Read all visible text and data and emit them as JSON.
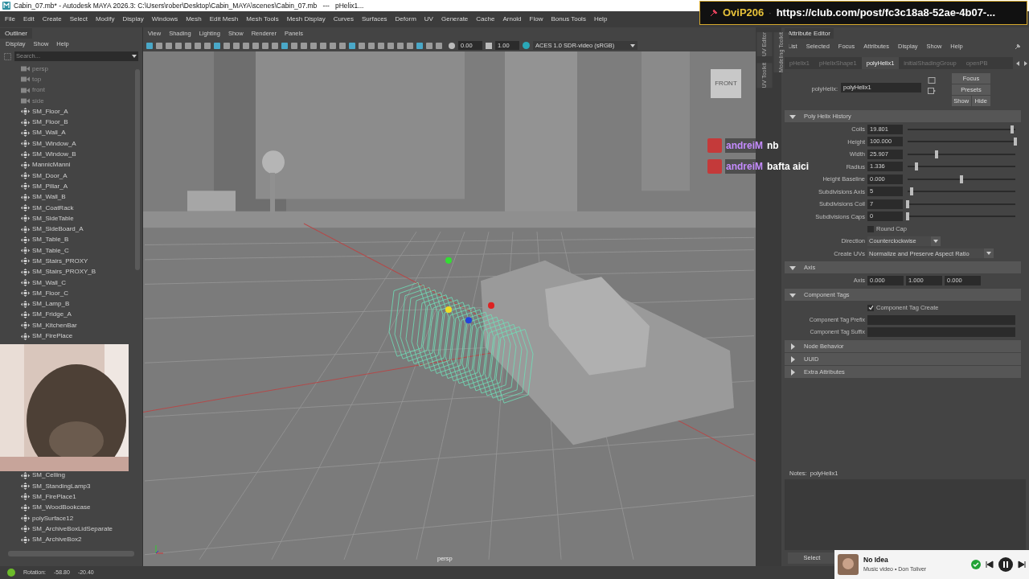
{
  "title_bar": {
    "title": "Cabin_07.mb* - Autodesk MAYA 2026.3: C:\\Users\\rober\\Desktop\\Cabin_MAYA\\scenes\\Cabin_07.mb   ---   pHelix1..."
  },
  "pinned_message": {
    "user": "OviP206",
    "separator": "·",
    "text": "https://club.com/post/fc3c18a8-52ae-4b07-..."
  },
  "menu_bar": [
    "File",
    "Edit",
    "Create",
    "Select",
    "Modify",
    "Display",
    "Windows",
    "Mesh",
    "Edit Mesh",
    "Mesh Tools",
    "Mesh Display",
    "Curves",
    "Surfaces",
    "Deform",
    "UV",
    "Generate",
    "Cache",
    "Arnold",
    "Flow",
    "Bonus Tools",
    "Help"
  ],
  "outliner": {
    "title": "Outliner",
    "menu": [
      "Display",
      "Show",
      "Help"
    ],
    "search_placeholder": "Search...",
    "items_top": [
      {
        "label": "persp",
        "kind": "camera"
      },
      {
        "label": "top",
        "kind": "camera"
      },
      {
        "label": "front",
        "kind": "camera"
      },
      {
        "label": "side",
        "kind": "camera"
      },
      {
        "label": "SM_Floor_A",
        "kind": "mesh"
      },
      {
        "label": "SM_Floor_B",
        "kind": "mesh"
      },
      {
        "label": "SM_Wall_A",
        "kind": "mesh"
      },
      {
        "label": "SM_Window_A",
        "kind": "mesh"
      },
      {
        "label": "SM_Window_B",
        "kind": "mesh"
      },
      {
        "label": "MannicManni",
        "kind": "mesh"
      },
      {
        "label": "SM_Door_A",
        "kind": "mesh"
      },
      {
        "label": "SM_Pillar_A",
        "kind": "mesh"
      },
      {
        "label": "SM_Wall_B",
        "kind": "mesh"
      },
      {
        "label": "SM_CoatRack",
        "kind": "mesh"
      },
      {
        "label": "SM_SideTable",
        "kind": "mesh"
      },
      {
        "label": "SM_SideBoard_A",
        "kind": "mesh"
      },
      {
        "label": "SM_Table_B",
        "kind": "mesh"
      },
      {
        "label": "SM_Table_C",
        "kind": "mesh"
      },
      {
        "label": "SM_Stairs_PROXY",
        "kind": "mesh"
      },
      {
        "label": "SM_Stairs_PROXY_B",
        "kind": "mesh"
      },
      {
        "label": "SM_Wall_C",
        "kind": "mesh"
      },
      {
        "label": "SM_Floor_C",
        "kind": "mesh"
      },
      {
        "label": "SM_Lamp_B",
        "kind": "mesh"
      },
      {
        "label": "SM_Fridge_A",
        "kind": "mesh"
      },
      {
        "label": "SM_KitchenBar",
        "kind": "mesh"
      },
      {
        "label": "SM_FirePlace",
        "kind": "mesh"
      }
    ],
    "items_bottom": [
      {
        "label": "SM_Celling",
        "kind": "mesh"
      },
      {
        "label": "SM_StandingLamp3",
        "kind": "mesh"
      },
      {
        "label": "SM_FirePlace1",
        "kind": "mesh"
      },
      {
        "label": "SM_WoodBookcase",
        "kind": "mesh"
      },
      {
        "label": "polySurface12",
        "kind": "mesh"
      },
      {
        "label": "SM_ArchiveBoxLidSeparate",
        "kind": "mesh"
      },
      {
        "label": "SM_ArchiveBox2",
        "kind": "mesh"
      }
    ]
  },
  "viewport": {
    "menu": [
      "View",
      "Shading",
      "Lighting",
      "Show",
      "Renderer",
      "Panels"
    ],
    "exposure": "0.00",
    "gamma": "1.00",
    "color_space": "ACES 1.0 SDR-video (sRGB)",
    "view_cube": "FRONT",
    "camera": "persp"
  },
  "side_tabs": [
    "UV Editor",
    "Modeling Toolkit",
    "UV Toolkit"
  ],
  "chat": [
    {
      "user": "andreiM",
      "message": "nb"
    },
    {
      "user": "andreiM",
      "message": "bafta aici"
    }
  ],
  "attribute_editor": {
    "title": "Attribute Editor",
    "menu": [
      "List",
      "Selected",
      "Focus",
      "Attributes",
      "Display",
      "Show",
      "Help"
    ],
    "tabs": [
      {
        "label": "pHelix1",
        "selected": false
      },
      {
        "label": "pHelixShape1",
        "selected": false
      },
      {
        "label": "polyHelix1",
        "selected": true
      },
      {
        "label": "initialShadingGroup",
        "selected": false
      },
      {
        "label": "openPB",
        "selected": false
      }
    ],
    "node_label": "polyHelix:",
    "node_value": "polyHelix1",
    "buttons": [
      "Focus",
      "Presets",
      "Show",
      "Hide"
    ],
    "sections": [
      {
        "title": "Poly Helix History",
        "expanded": true,
        "rows": [
          {
            "kind": "slider",
            "label": "Coils",
            "value": "19.801",
            "level": 0.97
          },
          {
            "kind": "slider",
            "label": "Height",
            "value": "100.000",
            "level": 1.0
          },
          {
            "kind": "slider",
            "label": "Width",
            "value": "25.907",
            "level": 0.27
          },
          {
            "kind": "slider",
            "label": "Radius",
            "value": "1.336",
            "level": 0.08
          },
          {
            "kind": "slider",
            "label": "Height Baseline",
            "value": "0.000",
            "level": 0.5
          },
          {
            "kind": "slider",
            "label": "Subdivisions Axis",
            "value": "5",
            "level": 0.04
          },
          {
            "kind": "slider",
            "label": "Subdivisions Coil",
            "value": "7",
            "level": 0.0
          },
          {
            "kind": "slider",
            "label": "Subdivisions Caps",
            "value": "0",
            "level": 0.0
          },
          {
            "kind": "checkbox",
            "label": "Round Cap",
            "checked": false
          },
          {
            "kind": "dropdown",
            "label": "Direction",
            "value": "Counterclockwise"
          },
          {
            "kind": "dropdown",
            "label": "Create UVs",
            "value": "Normalize and Preserve Aspect Ratio"
          }
        ]
      },
      {
        "title": "Axis",
        "expanded": true,
        "rows": [
          {
            "kind": "vector",
            "label": "Axis",
            "values": [
              "0.000",
              "1.000",
              "0.000"
            ]
          }
        ]
      },
      {
        "title": "Component Tags",
        "expanded": true,
        "rows": [
          {
            "kind": "checkbox",
            "label": "Component Tag Create",
            "checked": true
          },
          {
            "kind": "text_field",
            "label": "Component Tag Prefix"
          },
          {
            "kind": "text_field",
            "label": "Component Tag Suffix"
          }
        ]
      },
      {
        "title": "Node Behavior",
        "expanded": false
      },
      {
        "title": "UUID",
        "expanded": false
      },
      {
        "title": "Extra Attributes",
        "expanded": false
      }
    ],
    "notes_label": "Notes:  polyHelix1",
    "select_button": "Select"
  },
  "media": {
    "title": "No Idea",
    "subtitle": "Music video • Don Toliver"
  },
  "status_bar": {
    "label": "Rotation:",
    "values": [
      "-58.80",
      "-20.40"
    ]
  }
}
